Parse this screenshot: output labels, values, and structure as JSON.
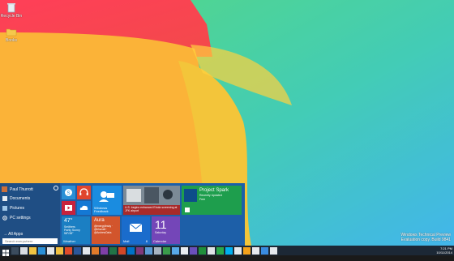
{
  "desktop": {
    "icons": [
      {
        "label": "Recycle Bin",
        "icon": "recycle-bin-icon"
      },
      {
        "label": "Books",
        "icon": "folder-icon"
      }
    ],
    "watermark": {
      "line1": "Windows Technical Preview",
      "line2": "Evaluation copy. Build 9841"
    }
  },
  "start_menu": {
    "user_name": "Paul Thurrott",
    "items": [
      {
        "label": "Documents",
        "icon": "documents-icon"
      },
      {
        "label": "Pictures",
        "icon": "pictures-icon"
      },
      {
        "label": "PC settings",
        "icon": "settings-icon"
      }
    ],
    "all_apps": "All Apps",
    "search_placeholder": "Search everywhere",
    "tiles": {
      "feedback": "Windows Feedback",
      "news": "U.S. begins enhanced Ebola screening at JFK airport",
      "spark_title": "Project Spark",
      "spark_sub": "Recently Updated",
      "spark_price": "Free",
      "weather_temp": "47°",
      "weather_place": "Smithers",
      "weather_desc": "Partly Sunny",
      "weather_range": "58°/38°",
      "weather_label": "Weather",
      "aura_title": "Aura",
      "aura_text": "@energyfinsky · @bhurraft · @AndrewOaks",
      "mail_label": "Mail",
      "mail_count": "8",
      "calendar_day": "11",
      "calendar_weekday": "Saturday",
      "calendar_label": "Calendar"
    }
  },
  "taskbar": {
    "apps": [
      "file-explorer-icon",
      "internet-explorer-icon",
      "mail-icon",
      "folder-icon",
      "word-icon",
      "chrome-icon",
      "firefox-icon",
      "onenote-icon",
      "excel-icon",
      "powerpoint-icon",
      "outlook-icon",
      "onenote-icon",
      "photos-icon",
      "settings-icon",
      "store-icon",
      "twitter-icon",
      "visual-studio-icon",
      "xbox-icon",
      "music-icon",
      "skype-icon",
      "app-icon",
      "app-icon",
      "app-icon",
      "app-icon",
      "app-icon",
      "app-icon"
    ],
    "time": "7:21 PM",
    "date": "10/11/2014"
  },
  "colors": {
    "start_bg": "#1d5fa8",
    "taskbar_bg": "#1c2836"
  }
}
